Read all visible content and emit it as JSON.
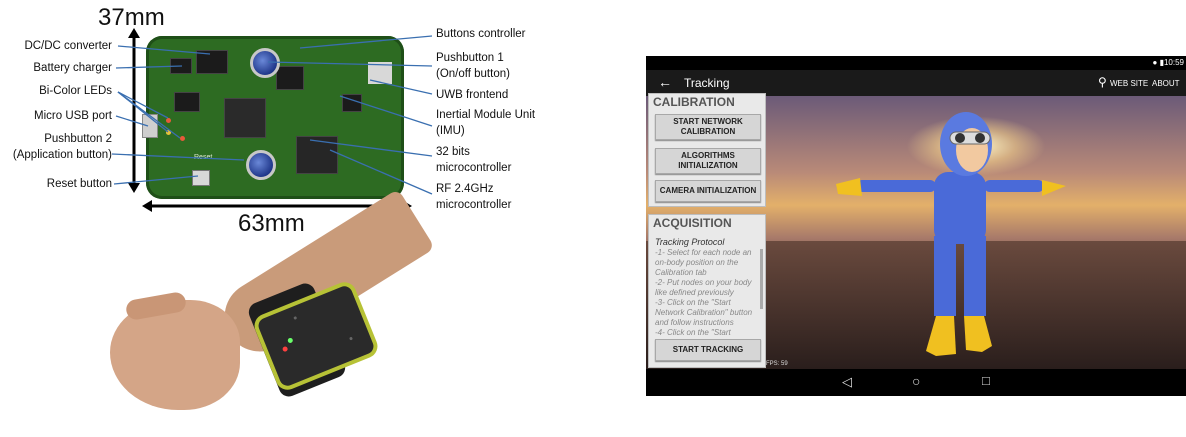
{
  "board_figure": {
    "height_dim": "37mm",
    "width_dim": "63mm",
    "left_labels": [
      "DC/DC converter",
      "Battery charger",
      "Bi-Color LEDs",
      "Micro USB port",
      "Pushbutton 2",
      "(Application button)",
      "Reset button"
    ],
    "right_labels": [
      "Buttons controller",
      "Pushbutton 1",
      "(On/off button)",
      "UWB frontend",
      "Inertial Module Unit",
      "(IMU)",
      "32 bits",
      "microcontroller",
      "RF 2.4GHz",
      "microcontroller"
    ],
    "silkscreen_reset": "Reset"
  },
  "tablet": {
    "status_time": "10:59",
    "title": "Tracking",
    "web_site": "WEB SITE",
    "about": "ABOUT",
    "calibration": {
      "title": "CALIBRATION",
      "buttons": [
        "START NETWORK\nCALIBRATION",
        "ALGORITHMS\nINITIALIZATION",
        "CAMERA INITIALIZATION"
      ]
    },
    "acquisition": {
      "title": "ACQUISITION",
      "protocol_title": "Tracking Protocol",
      "protocol_text": "  -1- Select for each node an\non-body position on the\nCalibration tab\n  -2- Put nodes on your body\nlike defined previously\n  -3- Click on the \"Start\nNetwork Calibration\" button\nand follow instructions\n  -4- Click on the \"Start",
      "button": "START TRACKING"
    },
    "fps": "FPS: 59",
    "nav": {
      "back": "◁",
      "home": "○",
      "recent": "□"
    }
  }
}
